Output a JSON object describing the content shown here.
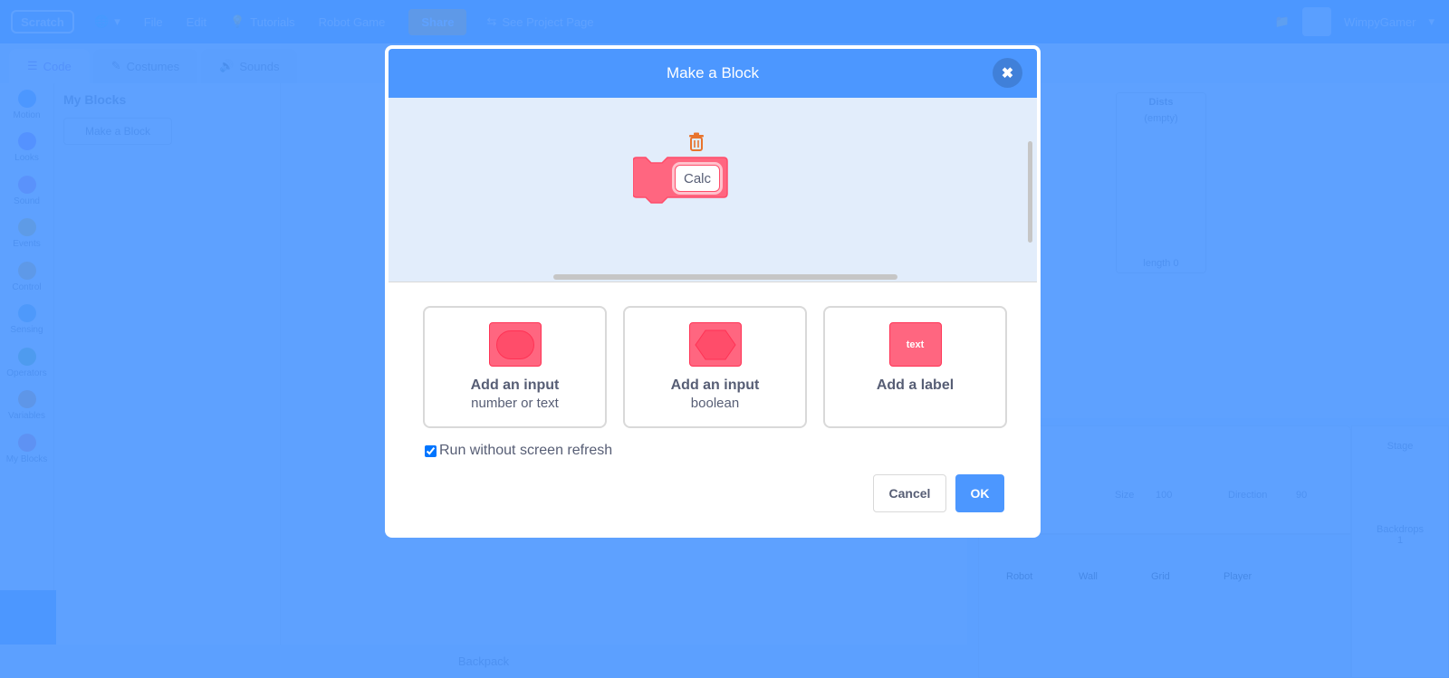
{
  "menubar": {
    "logo": "Scratch",
    "items": [
      "File",
      "Edit"
    ],
    "tutorials": "Tutorials",
    "project_title": "Robot Game",
    "share": "Share",
    "see_project_page": "See Project Page",
    "username": "WimpyGamer"
  },
  "editor_tabs": [
    "Code",
    "Costumes",
    "Sounds"
  ],
  "categories": [
    {
      "label": "Motion",
      "color": "#4c97ff"
    },
    {
      "label": "Looks",
      "color": "#9966ff"
    },
    {
      "label": "Sound",
      "color": "#cf63cf"
    },
    {
      "label": "Events",
      "color": "#ffbf00"
    },
    {
      "label": "Control",
      "color": "#ffab19"
    },
    {
      "label": "Sensing",
      "color": "#5cb1d6"
    },
    {
      "label": "Operators",
      "color": "#59c059"
    },
    {
      "label": "Variables",
      "color": "#ff8c1a"
    },
    {
      "label": "My Blocks",
      "color": "#ff6680"
    }
  ],
  "palette": {
    "header": "My Blocks",
    "make_block_button": "Make a Block"
  },
  "backpack_label": "Backpack",
  "stage": {
    "list_monitor_title": "Dists",
    "list_monitor_empty": "(empty)",
    "list_monitor_length": "length 0"
  },
  "sprite_info": {
    "size_label": "Size",
    "size_value": "100",
    "direction_label": "Direction",
    "direction_value": "90"
  },
  "sprites": [
    "Robot",
    "Wall",
    "Grid",
    "Player"
  ],
  "stage_pane": {
    "label": "Stage",
    "backdrops_label": "Backdrops",
    "backdrops_count": "1"
  },
  "modal": {
    "title": "Make a Block",
    "close_icon": "close-icon",
    "block_name_value": "Calc",
    "options": [
      {
        "title": "Add an input",
        "subtitle": "number or text",
        "icon": "oval-input-icon"
      },
      {
        "title": "Add an input",
        "subtitle": "boolean",
        "icon": "boolean-input-icon"
      },
      {
        "title": "Add a label",
        "subtitle": "",
        "icon": "label-icon",
        "icon_text": "text"
      }
    ],
    "run_without_refresh_label": "Run without screen refresh",
    "run_without_refresh_checked": true,
    "cancel_label": "Cancel",
    "ok_label": "OK",
    "accent_color": "#4c97ff",
    "block_color": "#ff6680"
  }
}
